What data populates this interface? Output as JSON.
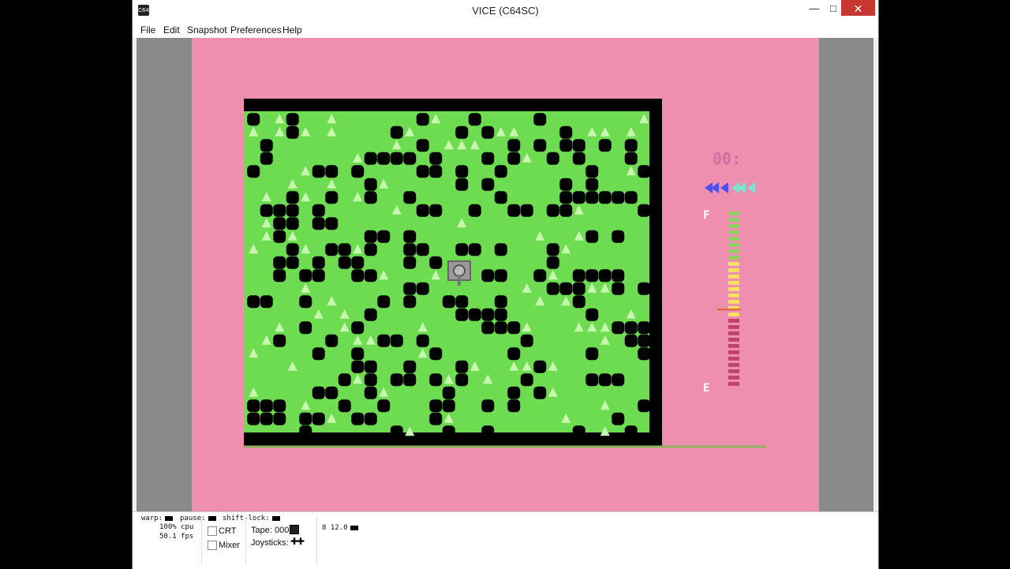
{
  "window": {
    "title": "VICE (C64SC)",
    "icon_text": "C64"
  },
  "menu": [
    "File",
    "Edit",
    "Snapshot",
    "Preferences",
    "Help"
  ],
  "hud": {
    "counter": "00:",
    "fuel_full_label": "F",
    "fuel_empty_label": "E",
    "fuel_level": 0.45
  },
  "status": {
    "warp_label": "warp:",
    "pause_label": "pause:",
    "shiftlock_label": "shift-lock:",
    "cpu": "100% cpu",
    "fps": "50.1 fps",
    "crt_label": "CRT",
    "mixer_label": "Mixer",
    "tape_label": "Tape:",
    "tape_counter": "000",
    "joysticks_label": "Joysticks:",
    "drive_info": "8 12.0"
  },
  "colors": {
    "border": "#ef8fb0",
    "field": "#6edc50",
    "tree": "#c8f8b0",
    "rock": "#000000",
    "hud_text": "#d070a0"
  }
}
